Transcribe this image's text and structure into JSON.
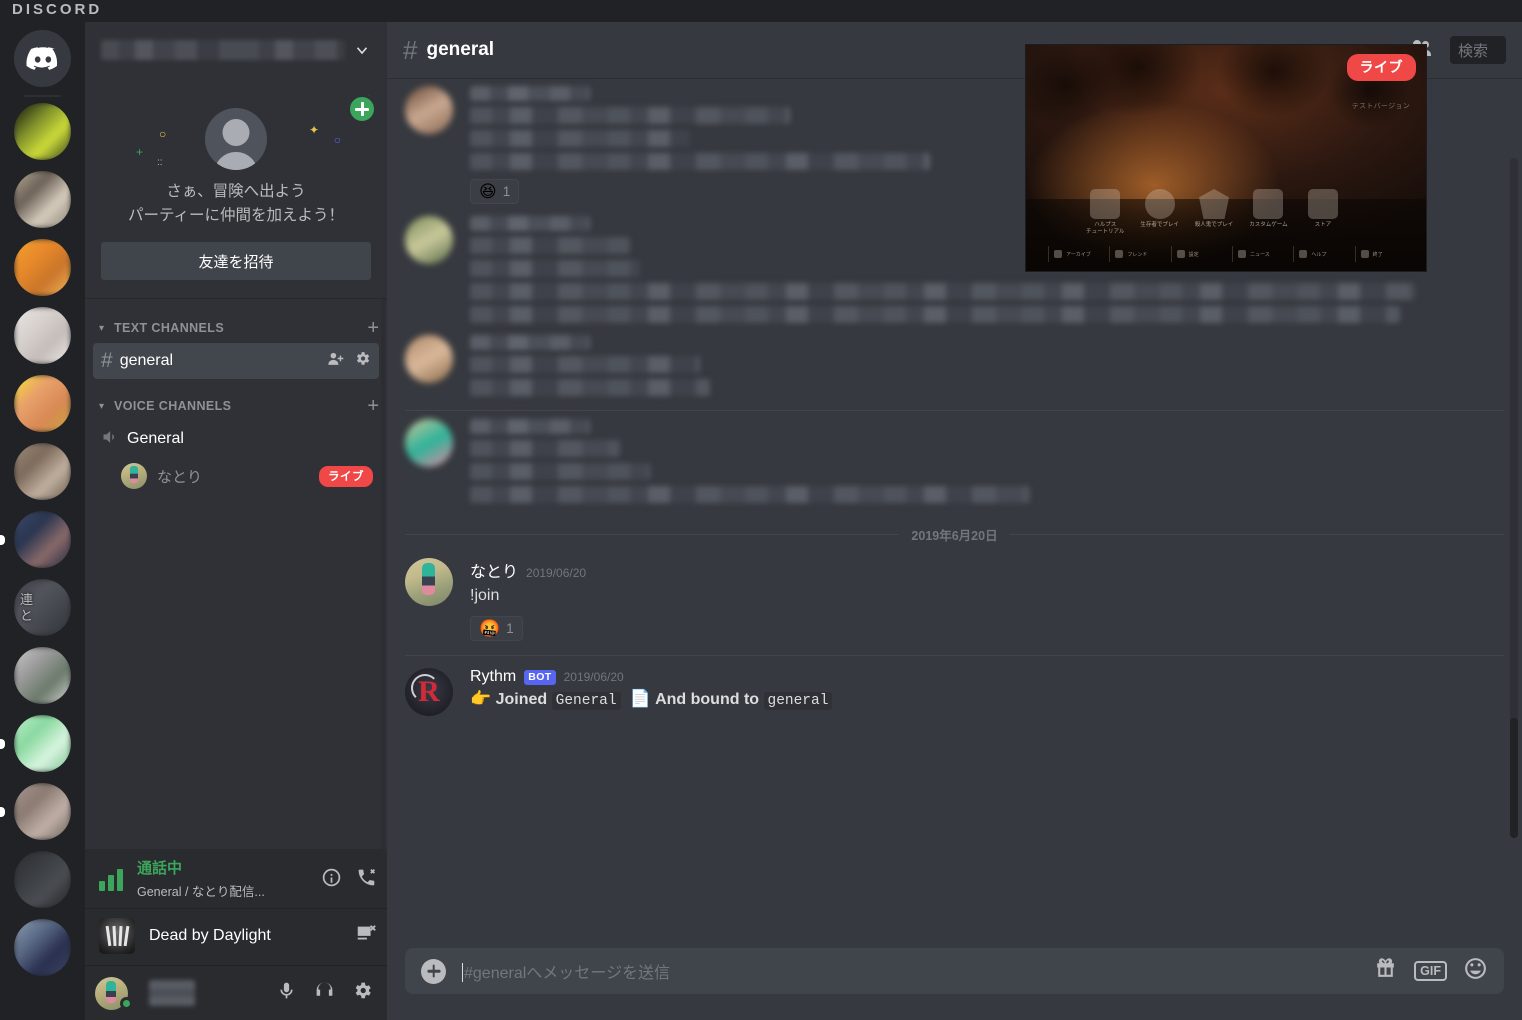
{
  "app": {
    "wordmark": "DISCORD"
  },
  "server_rail": {
    "home_icon": "discord-home-icon",
    "servers": [
      {
        "name": "server-1",
        "colors": [
          "#0d0d0d",
          "#7b8c2a",
          "#cddc39",
          "#2f3a1a"
        ],
        "unread": false
      },
      {
        "name": "server-2",
        "colors": [
          "#b9aa93",
          "#6b6157",
          "#d7cdbd",
          "#8a8075"
        ],
        "unread": false
      },
      {
        "name": "server-3",
        "colors": [
          "#f0a030",
          "#e8892a",
          "#c9762a",
          "#f5b45a"
        ],
        "unread": false
      },
      {
        "name": "server-4",
        "colors": [
          "#e9e6e4",
          "#d8d2ce",
          "#c4bcb8",
          "#efecea"
        ],
        "unread": false
      },
      {
        "name": "server-5",
        "colors": [
          "#f5e03a",
          "#e8a06a",
          "#d98a55",
          "#c9a03a"
        ],
        "unread": false
      },
      {
        "name": "server-6",
        "colors": [
          "#9a8a7a",
          "#7d6a5a",
          "#c0b0a0",
          "#6a5a4a"
        ],
        "unread": false
      },
      {
        "name": "server-7",
        "colors": [
          "#3a4a6a",
          "#2a3550",
          "#8a6a6a",
          "#1f2740"
        ],
        "unread": true
      },
      {
        "name": "server-8",
        "label": "連\nと",
        "colors": [
          "#3a3d44",
          "#52555c",
          "#44474e",
          "#2f3237"
        ],
        "unread": false
      },
      {
        "name": "server-9",
        "colors": [
          "#c9c9c9",
          "#9a9a9a",
          "#6a7a6a",
          "#d5d5d5"
        ],
        "unread": false
      },
      {
        "name": "server-10",
        "colors": [
          "#b9f0c8",
          "#8ad8a0",
          "#d8f5e0",
          "#7ac090"
        ],
        "unread": true
      },
      {
        "name": "server-11",
        "colors": [
          "#a89890",
          "#8a7a72",
          "#c0b0a8",
          "#6a5f58"
        ],
        "unread": true
      },
      {
        "name": "server-12",
        "colors": [
          "#2a2c30",
          "#3a3d42",
          "#4a4d52",
          "#202225"
        ],
        "unread": false
      },
      {
        "name": "server-13",
        "colors": [
          "#8a9ab0",
          "#5a6a85",
          "#2a3050",
          "#3a4560"
        ],
        "unread": false
      }
    ]
  },
  "sidebar": {
    "server_name_blurred": true,
    "dropdown_icon": "chevron-down-icon",
    "invite_card": {
      "close_icon": "close-icon",
      "illustration": "add-friend-avatar-illustration",
      "line1": "さぁ、冒険へ出よう",
      "line2": "パーティーに仲間を加えよう！",
      "button_label": "友達を招待"
    },
    "categories": [
      {
        "name": "TEXT CHANNELS",
        "collapse_icon": "chevron-down-icon",
        "add_icon": "plus-icon",
        "channels": [
          {
            "name": "general",
            "prefix": "#",
            "active": true,
            "actions": [
              "create-invite-icon",
              "edit-channel-icon"
            ]
          }
        ]
      },
      {
        "name": "VOICE CHANNELS",
        "collapse_icon": "chevron-down-icon",
        "add_icon": "plus-icon",
        "channels": [
          {
            "name": "General",
            "icon": "speaker-icon",
            "members": [
              {
                "name": "なとり",
                "badge": "ライブ"
              }
            ]
          }
        ]
      }
    ],
    "voice_status": {
      "signal_icon": "signal-bars-icon",
      "title": "通話中",
      "subtitle": "General / なとり配信...",
      "info_icon": "info-icon",
      "disconnect_icon": "disconnect-call-icon"
    },
    "game_status": {
      "icon": "dead-by-daylight-icon",
      "name": "Dead by Daylight",
      "stop_icon": "stop-stream-icon"
    },
    "user_panel": {
      "avatar": "user-avatar",
      "status": "online",
      "name_blurred": true,
      "icons": [
        "microphone-icon",
        "headphones-icon",
        "settings-gear-icon"
      ]
    }
  },
  "main": {
    "header": {
      "hash": "#",
      "channel": "general",
      "members_icon": "members-icon",
      "search_placeholder": "検索"
    },
    "messages": [
      {
        "id": "m1",
        "type": "blurred",
        "avatar_colors": [
          "#6a4a3a",
          "#c9a890",
          "#8a6a55"
        ],
        "lines": [
          320,
          220,
          460
        ],
        "reaction": {
          "emoji": "😆",
          "count": "1"
        }
      },
      {
        "id": "m2",
        "type": "blurred",
        "avatar_colors": [
          "#7a8a5a",
          "#c9c99a",
          "#5a6a4a"
        ],
        "lines": [
          160,
          170,
          945,
          930
        ]
      },
      {
        "id": "m3",
        "type": "blurred",
        "avatar_colors": [
          "#b08a6a",
          "#d9b89a",
          "#8a6a4a"
        ],
        "lines": [
          230,
          240
        ]
      },
      {
        "id": "m4",
        "type": "blurred",
        "avatar_colors": [
          "#cfc79a",
          "#2fb39a",
          "#e08aa0"
        ],
        "lines": [
          150,
          180,
          560
        ]
      }
    ],
    "date_divider": "2019年6月20日",
    "message_join": {
      "author": "なとり",
      "timestamp": "2019/06/20",
      "text": "!join",
      "reaction": {
        "emoji": "🤬",
        "count": "1"
      }
    },
    "message_bot": {
      "author": "Rythm",
      "bot_badge": "BOT",
      "timestamp": "2019/06/20",
      "emoji1": "👉",
      "joined_label": "Joined",
      "joined_channel": "General",
      "emoji2": "📄",
      "bound_label": "And bound to",
      "bound_channel": "general"
    },
    "composer": {
      "add_icon": "plus-circle-icon",
      "placeholder": "#generalへメッセージを送信",
      "icons": [
        "gift-icon",
        "gif-icon",
        "emoji-icon"
      ],
      "gif_label": "GIF"
    },
    "scrollbar": "vertical-scrollbar"
  },
  "stream_overlay": {
    "title": "Dead by Daylight stream preview",
    "live_badge": "ライブ",
    "version_text": "テストバージョン",
    "menu_items": [
      {
        "icon": "tutorial-icon",
        "label": "ハルプス\nチュートリアル"
      },
      {
        "icon": "survivor-icon",
        "label": "生存者でプレイ"
      },
      {
        "icon": "killer-icon",
        "label": "殺人鬼でプレイ"
      },
      {
        "icon": "custom-game-icon",
        "label": "カスタムゲーム"
      },
      {
        "icon": "store-icon",
        "label": "ストア"
      }
    ],
    "bottom_items": [
      {
        "label": "アーカイブ"
      },
      {
        "label": "フレンド"
      },
      {
        "label": "設定"
      },
      {
        "label": "ニュース"
      },
      {
        "label": "ヘルプ"
      },
      {
        "label": "終了"
      }
    ]
  },
  "colors": {
    "brand": "#5865f2",
    "online": "#3ba55c",
    "live": "#f04747",
    "bg_rail": "#202225",
    "bg_sidebar": "#2f3136",
    "bg_main": "#36393f"
  }
}
